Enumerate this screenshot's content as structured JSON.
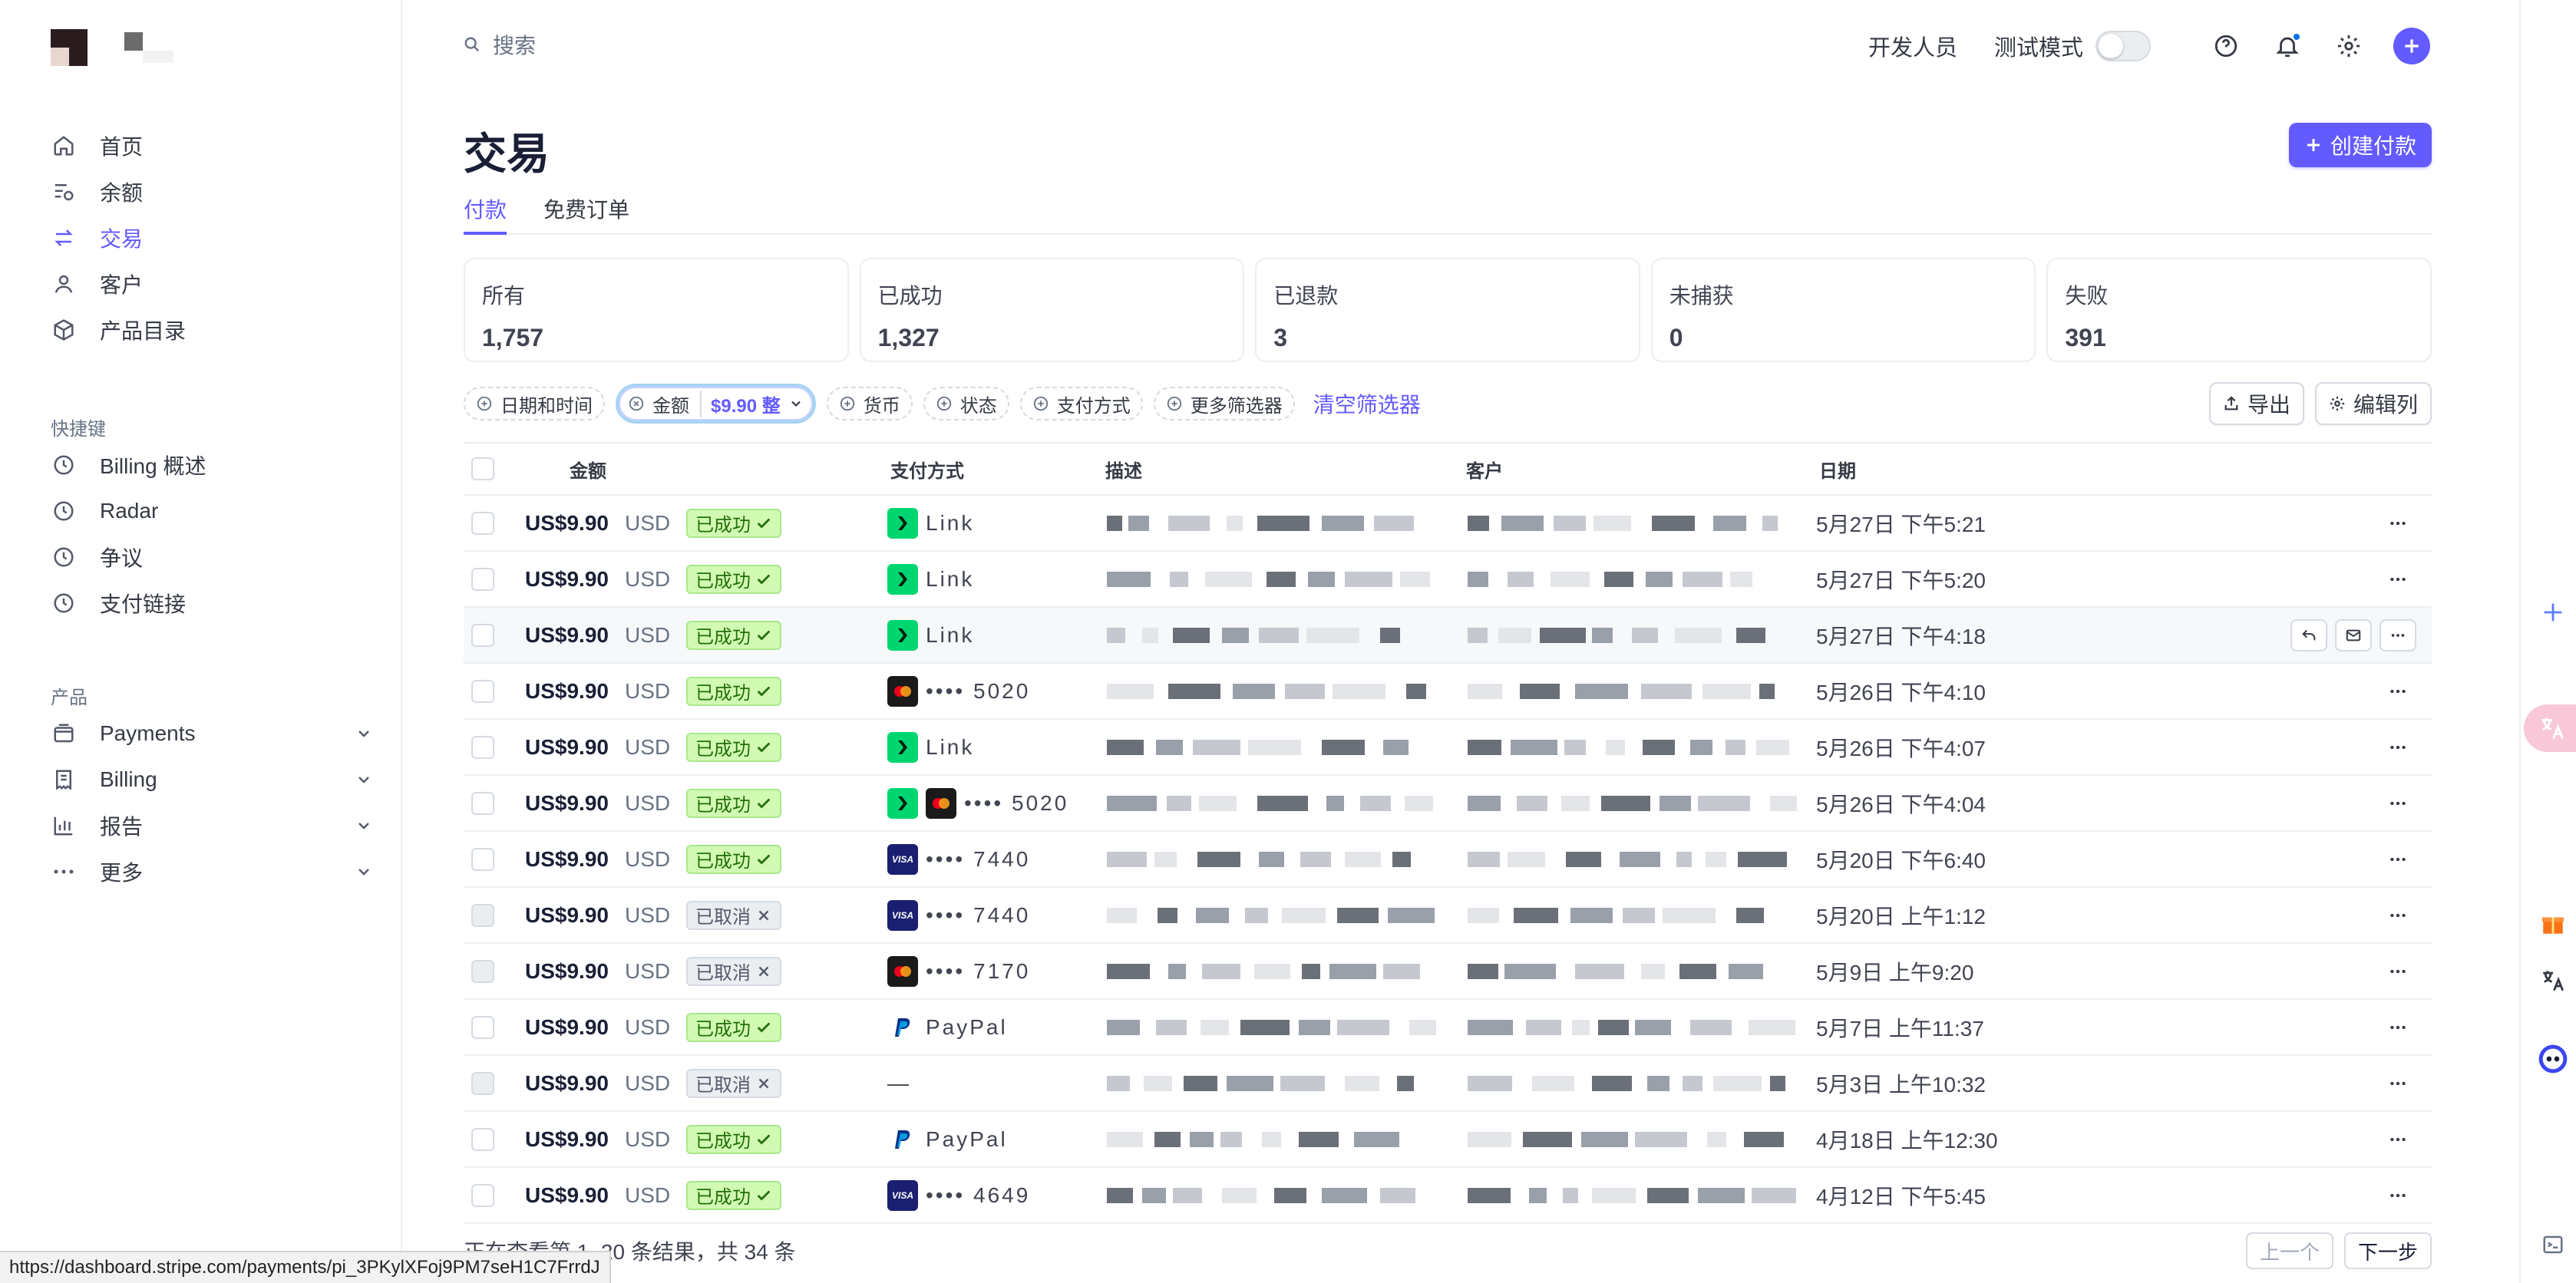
{
  "topbar": {
    "search_placeholder": "搜索",
    "developer": "开发人员",
    "test_mode": "测试模式"
  },
  "sidebar": {
    "main_items": [
      {
        "label": "首页",
        "icon": "home-icon"
      },
      {
        "label": "余额",
        "icon": "balance-icon"
      },
      {
        "label": "交易",
        "icon": "transactions-icon",
        "active": true
      },
      {
        "label": "客户",
        "icon": "person-icon"
      },
      {
        "label": "产品目录",
        "icon": "box-icon"
      }
    ],
    "shortcuts_label": "快捷键",
    "shortcuts": [
      {
        "label": "Billing 概述",
        "icon": "clock-icon"
      },
      {
        "label": "Radar",
        "icon": "clock-icon"
      },
      {
        "label": "争议",
        "icon": "clock-icon"
      },
      {
        "label": "支付链接",
        "icon": "clock-icon"
      }
    ],
    "products_label": "产品",
    "products": [
      {
        "label": "Payments",
        "icon": "wallet-icon"
      },
      {
        "label": "Billing",
        "icon": "receipt-icon"
      },
      {
        "label": "报告",
        "icon": "bar-chart-icon"
      },
      {
        "label": "更多",
        "icon": "more-dots-icon"
      }
    ]
  },
  "page": {
    "title": "交易",
    "create_button": "创建付款",
    "tabs": [
      {
        "label": "付款",
        "active": true
      },
      {
        "label": "免费订单",
        "active": false
      }
    ]
  },
  "summary_cards": [
    {
      "label": "所有",
      "value": "1,757"
    },
    {
      "label": "已成功",
      "value": "1,327"
    },
    {
      "label": "已退款",
      "value": "3"
    },
    {
      "label": "未捕获",
      "value": "0"
    },
    {
      "label": "失败",
      "value": "391"
    }
  ],
  "filters": {
    "date": "日期和时间",
    "amount_label": "金额",
    "amount_value": "$9.90 整",
    "currency": "货币",
    "status": "状态",
    "payment_method": "支付方式",
    "more_filters": "更多筛选器",
    "clear": "清空筛选器",
    "export": "导出",
    "edit_columns": "编辑列"
  },
  "table": {
    "headers": {
      "amount": "金额",
      "payment_method": "支付方式",
      "description": "描述",
      "customer": "客户",
      "date": "日期"
    },
    "rows": [
      {
        "amount": "US$9.90",
        "currency": "USD",
        "status": "已成功",
        "status_type": "ok",
        "method": "link",
        "method_text": "Link",
        "date": "5月27日 下午5:21"
      },
      {
        "amount": "US$9.90",
        "currency": "USD",
        "status": "已成功",
        "status_type": "ok",
        "method": "link",
        "method_text": "Link",
        "date": "5月27日 下午5:20"
      },
      {
        "amount": "US$9.90",
        "currency": "USD",
        "status": "已成功",
        "status_type": "ok",
        "method": "link",
        "method_text": "Link",
        "date": "5月27日 下午4:18",
        "hover": true
      },
      {
        "amount": "US$9.90",
        "currency": "USD",
        "status": "已成功",
        "status_type": "ok",
        "method": "mastercard",
        "method_text": "•••• 5020",
        "date": "5月26日 下午4:10"
      },
      {
        "amount": "US$9.90",
        "currency": "USD",
        "status": "已成功",
        "status_type": "ok",
        "method": "link",
        "method_text": "Link",
        "date": "5月26日 下午4:07"
      },
      {
        "amount": "US$9.90",
        "currency": "USD",
        "status": "已成功",
        "status_type": "ok",
        "method": "link+mastercard",
        "method_text": "•••• 5020",
        "date": "5月26日 下午4:04"
      },
      {
        "amount": "US$9.90",
        "currency": "USD",
        "status": "已成功",
        "status_type": "ok",
        "method": "visa",
        "method_text": "•••• 7440",
        "date": "5月20日 下午6:40"
      },
      {
        "amount": "US$9.90",
        "currency": "USD",
        "status": "已取消",
        "status_type": "cancel",
        "method": "visa",
        "method_text": "•••• 7440",
        "date": "5月20日 上午1:12"
      },
      {
        "amount": "US$9.90",
        "currency": "USD",
        "status": "已取消",
        "status_type": "cancel",
        "method": "mastercard",
        "method_text": "•••• 7170",
        "date": "5月9日 上午9:20"
      },
      {
        "amount": "US$9.90",
        "currency": "USD",
        "status": "已成功",
        "status_type": "ok",
        "method": "paypal",
        "method_text": "PayPal",
        "date": "5月7日 上午11:37"
      },
      {
        "amount": "US$9.90",
        "currency": "USD",
        "status": "已取消",
        "status_type": "cancel",
        "method": "none",
        "method_text": "—",
        "date": "5月3日 上午10:32"
      },
      {
        "amount": "US$9.90",
        "currency": "USD",
        "status": "已成功",
        "status_type": "ok",
        "method": "paypal",
        "method_text": "PayPal",
        "date": "4月18日 上午12:30"
      },
      {
        "amount": "US$9.90",
        "currency": "USD",
        "status": "已成功",
        "status_type": "ok",
        "method": "visa",
        "method_text": "•••• 4649",
        "date": "4月12日 下午5:45"
      }
    ]
  },
  "footer": {
    "summary": "正在查看第 1–20 条结果，共 34 条",
    "prev": "上一个",
    "next": "下一步"
  },
  "status_url": "https://dashboard.stripe.com/payments/pi_3PKylXFoj9PM7seH1C7FrrdJ",
  "colors": {
    "accent": "#635bff",
    "success_bg": "#d1fab3",
    "success_fg": "#217005",
    "link_green": "#00d66f"
  }
}
